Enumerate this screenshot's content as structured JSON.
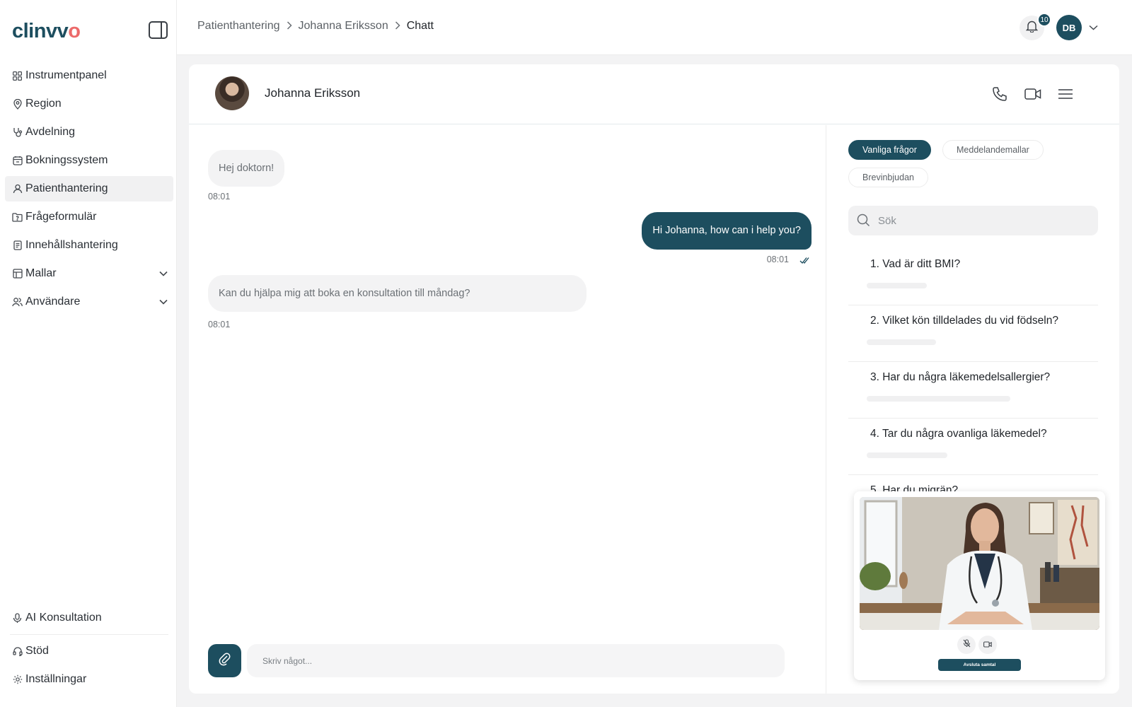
{
  "app": {
    "logo_main": "clinvv",
    "logo_accent": "o",
    "brand_color": "#1d4e5f",
    "accent_color": "#ec6a6a"
  },
  "sidebar": {
    "items": [
      {
        "label": "Instrumentpanel",
        "icon": "grid-icon"
      },
      {
        "label": "Region",
        "icon": "map-pin-icon"
      },
      {
        "label": "Avdelning",
        "icon": "stethoscope-icon"
      },
      {
        "label": "Bokningssystem",
        "icon": "calendar-icon"
      },
      {
        "label": "Patienthantering",
        "icon": "user-icon",
        "active": true
      },
      {
        "label": "Frågeformulär",
        "icon": "folder-question-icon"
      },
      {
        "label": "Innehållshantering",
        "icon": "document-icon"
      },
      {
        "label": "Mallar",
        "icon": "table-icon",
        "expandable": true
      },
      {
        "label": "Användare",
        "icon": "users-icon",
        "expandable": true
      }
    ],
    "bottom": [
      {
        "label": "AI Konsultation",
        "icon": "microphone-icon"
      },
      {
        "label": "Stöd",
        "icon": "headset-icon"
      },
      {
        "label": "Inställningar",
        "icon": "gear-icon"
      }
    ]
  },
  "topbar": {
    "breadcrumb": [
      "Patienthantering",
      "Johanna Eriksson",
      "Chatt"
    ],
    "notification_count": "10",
    "user_initials": "DB"
  },
  "chat": {
    "patient_name": "Johanna Eriksson",
    "messages": [
      {
        "direction": "in",
        "text": "Hej doktorn!",
        "time": "08:01"
      },
      {
        "direction": "out",
        "text": "Hi Johanna, how can i help you?",
        "time": "08:01",
        "read": true
      },
      {
        "direction": "in",
        "text": "Kan du hjälpa mig att boka en konsultation till måndag?",
        "time": "08:01"
      }
    ],
    "composer_placeholder": "Skriv något..."
  },
  "panel": {
    "tabs": [
      "Vanliga frågor",
      "Meddelandemallar",
      "Brevinbjudan"
    ],
    "active_tab": "Vanliga frågor",
    "search_placeholder": "Sök",
    "questions": [
      "1. Vad är ditt BMI?",
      "2. Vilket kön tilldelades du vid födseln?",
      "3. Har du några läkemedelsallergier?",
      "4. Tar du några ovanliga läkemedel?",
      "5. Har du migrän?"
    ]
  },
  "video": {
    "end_call_label": "Avsluta samtal"
  }
}
